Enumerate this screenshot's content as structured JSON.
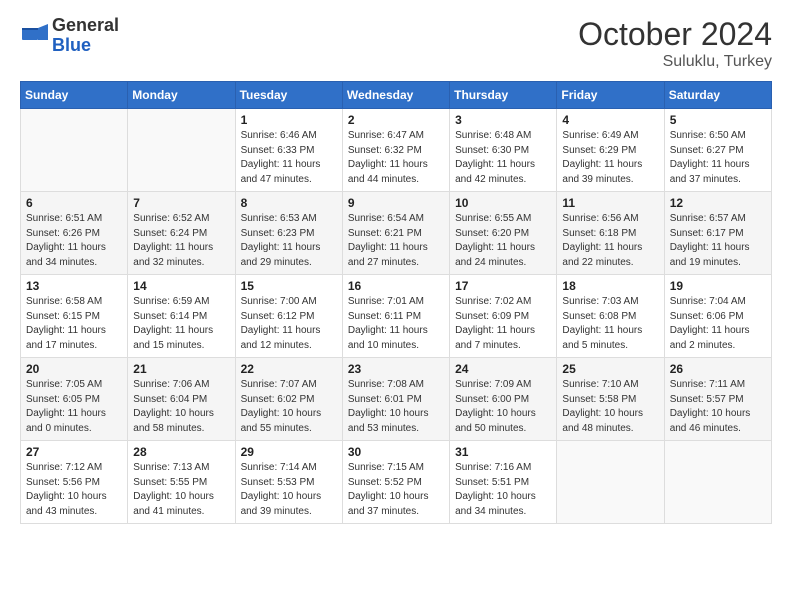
{
  "logo": {
    "text_general": "General",
    "text_blue": "Blue"
  },
  "header": {
    "month": "October 2024",
    "location": "Suluklu, Turkey"
  },
  "weekdays": [
    "Sunday",
    "Monday",
    "Tuesday",
    "Wednesday",
    "Thursday",
    "Friday",
    "Saturday"
  ],
  "weeks": [
    [
      {
        "day": "",
        "sunrise": "",
        "sunset": "",
        "daylight": ""
      },
      {
        "day": "",
        "sunrise": "",
        "sunset": "",
        "daylight": ""
      },
      {
        "day": "1",
        "sunrise": "Sunrise: 6:46 AM",
        "sunset": "Sunset: 6:33 PM",
        "daylight": "Daylight: 11 hours and 47 minutes."
      },
      {
        "day": "2",
        "sunrise": "Sunrise: 6:47 AM",
        "sunset": "Sunset: 6:32 PM",
        "daylight": "Daylight: 11 hours and 44 minutes."
      },
      {
        "day": "3",
        "sunrise": "Sunrise: 6:48 AM",
        "sunset": "Sunset: 6:30 PM",
        "daylight": "Daylight: 11 hours and 42 minutes."
      },
      {
        "day": "4",
        "sunrise": "Sunrise: 6:49 AM",
        "sunset": "Sunset: 6:29 PM",
        "daylight": "Daylight: 11 hours and 39 minutes."
      },
      {
        "day": "5",
        "sunrise": "Sunrise: 6:50 AM",
        "sunset": "Sunset: 6:27 PM",
        "daylight": "Daylight: 11 hours and 37 minutes."
      }
    ],
    [
      {
        "day": "6",
        "sunrise": "Sunrise: 6:51 AM",
        "sunset": "Sunset: 6:26 PM",
        "daylight": "Daylight: 11 hours and 34 minutes."
      },
      {
        "day": "7",
        "sunrise": "Sunrise: 6:52 AM",
        "sunset": "Sunset: 6:24 PM",
        "daylight": "Daylight: 11 hours and 32 minutes."
      },
      {
        "day": "8",
        "sunrise": "Sunrise: 6:53 AM",
        "sunset": "Sunset: 6:23 PM",
        "daylight": "Daylight: 11 hours and 29 minutes."
      },
      {
        "day": "9",
        "sunrise": "Sunrise: 6:54 AM",
        "sunset": "Sunset: 6:21 PM",
        "daylight": "Daylight: 11 hours and 27 minutes."
      },
      {
        "day": "10",
        "sunrise": "Sunrise: 6:55 AM",
        "sunset": "Sunset: 6:20 PM",
        "daylight": "Daylight: 11 hours and 24 minutes."
      },
      {
        "day": "11",
        "sunrise": "Sunrise: 6:56 AM",
        "sunset": "Sunset: 6:18 PM",
        "daylight": "Daylight: 11 hours and 22 minutes."
      },
      {
        "day": "12",
        "sunrise": "Sunrise: 6:57 AM",
        "sunset": "Sunset: 6:17 PM",
        "daylight": "Daylight: 11 hours and 19 minutes."
      }
    ],
    [
      {
        "day": "13",
        "sunrise": "Sunrise: 6:58 AM",
        "sunset": "Sunset: 6:15 PM",
        "daylight": "Daylight: 11 hours and 17 minutes."
      },
      {
        "day": "14",
        "sunrise": "Sunrise: 6:59 AM",
        "sunset": "Sunset: 6:14 PM",
        "daylight": "Daylight: 11 hours and 15 minutes."
      },
      {
        "day": "15",
        "sunrise": "Sunrise: 7:00 AM",
        "sunset": "Sunset: 6:12 PM",
        "daylight": "Daylight: 11 hours and 12 minutes."
      },
      {
        "day": "16",
        "sunrise": "Sunrise: 7:01 AM",
        "sunset": "Sunset: 6:11 PM",
        "daylight": "Daylight: 11 hours and 10 minutes."
      },
      {
        "day": "17",
        "sunrise": "Sunrise: 7:02 AM",
        "sunset": "Sunset: 6:09 PM",
        "daylight": "Daylight: 11 hours and 7 minutes."
      },
      {
        "day": "18",
        "sunrise": "Sunrise: 7:03 AM",
        "sunset": "Sunset: 6:08 PM",
        "daylight": "Daylight: 11 hours and 5 minutes."
      },
      {
        "day": "19",
        "sunrise": "Sunrise: 7:04 AM",
        "sunset": "Sunset: 6:06 PM",
        "daylight": "Daylight: 11 hours and 2 minutes."
      }
    ],
    [
      {
        "day": "20",
        "sunrise": "Sunrise: 7:05 AM",
        "sunset": "Sunset: 6:05 PM",
        "daylight": "Daylight: 11 hours and 0 minutes."
      },
      {
        "day": "21",
        "sunrise": "Sunrise: 7:06 AM",
        "sunset": "Sunset: 6:04 PM",
        "daylight": "Daylight: 10 hours and 58 minutes."
      },
      {
        "day": "22",
        "sunrise": "Sunrise: 7:07 AM",
        "sunset": "Sunset: 6:02 PM",
        "daylight": "Daylight: 10 hours and 55 minutes."
      },
      {
        "day": "23",
        "sunrise": "Sunrise: 7:08 AM",
        "sunset": "Sunset: 6:01 PM",
        "daylight": "Daylight: 10 hours and 53 minutes."
      },
      {
        "day": "24",
        "sunrise": "Sunrise: 7:09 AM",
        "sunset": "Sunset: 6:00 PM",
        "daylight": "Daylight: 10 hours and 50 minutes."
      },
      {
        "day": "25",
        "sunrise": "Sunrise: 7:10 AM",
        "sunset": "Sunset: 5:58 PM",
        "daylight": "Daylight: 10 hours and 48 minutes."
      },
      {
        "day": "26",
        "sunrise": "Sunrise: 7:11 AM",
        "sunset": "Sunset: 5:57 PM",
        "daylight": "Daylight: 10 hours and 46 minutes."
      }
    ],
    [
      {
        "day": "27",
        "sunrise": "Sunrise: 7:12 AM",
        "sunset": "Sunset: 5:56 PM",
        "daylight": "Daylight: 10 hours and 43 minutes."
      },
      {
        "day": "28",
        "sunrise": "Sunrise: 7:13 AM",
        "sunset": "Sunset: 5:55 PM",
        "daylight": "Daylight: 10 hours and 41 minutes."
      },
      {
        "day": "29",
        "sunrise": "Sunrise: 7:14 AM",
        "sunset": "Sunset: 5:53 PM",
        "daylight": "Daylight: 10 hours and 39 minutes."
      },
      {
        "day": "30",
        "sunrise": "Sunrise: 7:15 AM",
        "sunset": "Sunset: 5:52 PM",
        "daylight": "Daylight: 10 hours and 37 minutes."
      },
      {
        "day": "31",
        "sunrise": "Sunrise: 7:16 AM",
        "sunset": "Sunset: 5:51 PM",
        "daylight": "Daylight: 10 hours and 34 minutes."
      },
      {
        "day": "",
        "sunrise": "",
        "sunset": "",
        "daylight": ""
      },
      {
        "day": "",
        "sunrise": "",
        "sunset": "",
        "daylight": ""
      }
    ]
  ]
}
